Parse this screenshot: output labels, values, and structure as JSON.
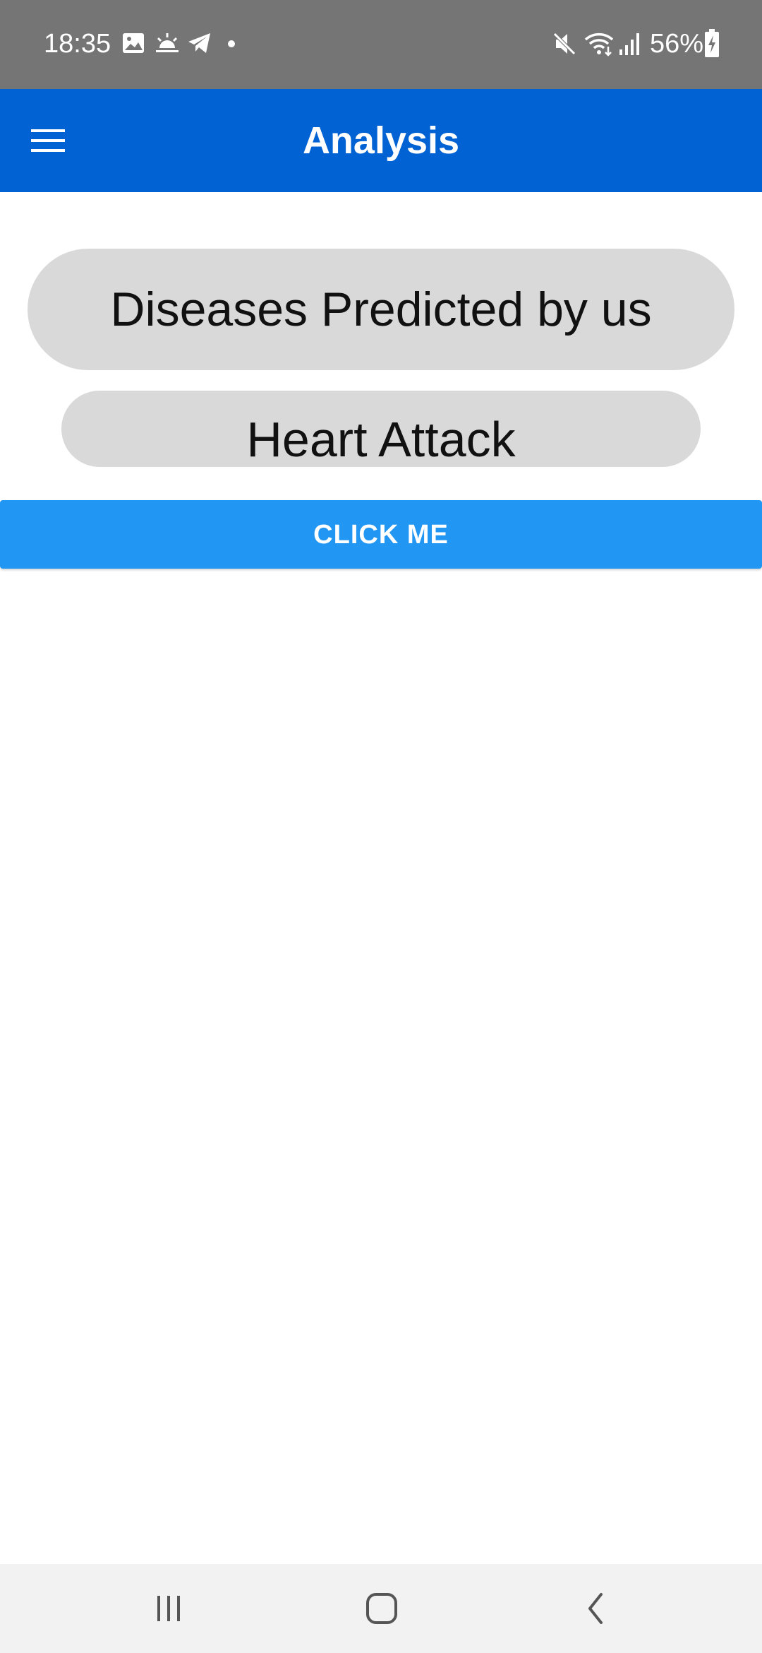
{
  "status_bar": {
    "time": "18:35",
    "battery": "56%",
    "icons": [
      "gallery-icon",
      "weather-icon",
      "telegram-icon",
      "notification-dot-icon",
      "mute-icon",
      "wifi-icon",
      "signal-icon",
      "battery-icon"
    ]
  },
  "app_bar": {
    "title": "Analysis",
    "menu_icon": "hamburger-menu-icon"
  },
  "content": {
    "section_label": "Diseases Predicted by us",
    "prediction": "Heart Attack",
    "button_label": "CLICK ME"
  },
  "nav_bar": {
    "icons": [
      "recent-apps-icon",
      "home-icon",
      "back-icon"
    ]
  },
  "colors": {
    "status_bar": "#757575",
    "app_bar": "#0062d3",
    "pill": "#d9d9d9",
    "button": "#2196f3",
    "nav_bar": "#f2f2f2"
  }
}
